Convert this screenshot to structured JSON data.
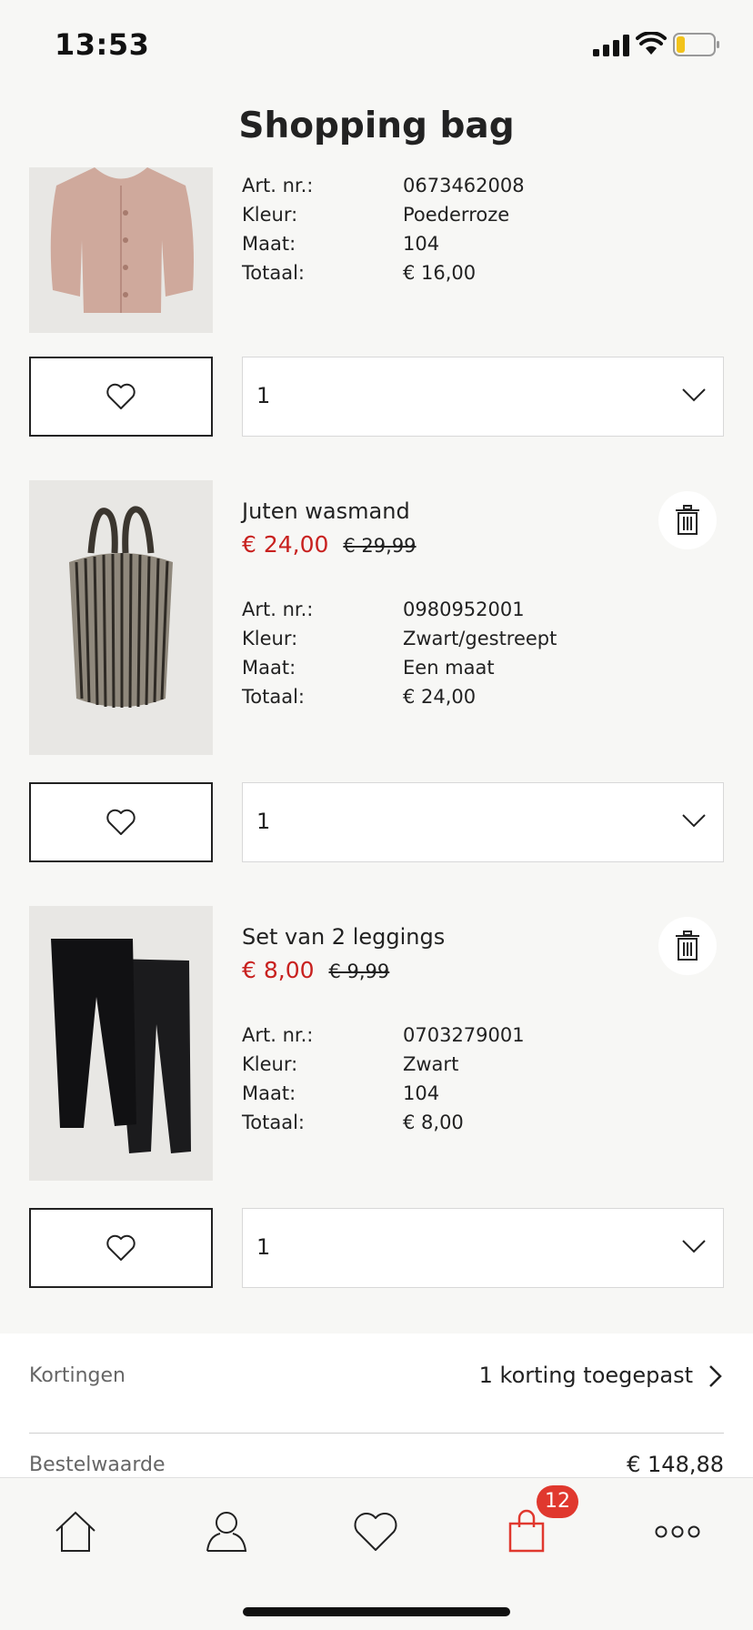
{
  "status_bar": {
    "time": "13:53"
  },
  "header": {
    "title": "Shopping bag"
  },
  "labels": {
    "art_nr": "Art. nr.:",
    "color": "Kleur:",
    "size": "Maat:",
    "total": "Totaal:"
  },
  "products": [
    {
      "name": "",
      "art_nr": "0673462008",
      "color": "Poederroze",
      "size": "104",
      "total": "€ 16,00",
      "quantity": "1",
      "image": "knit-cardigan-pink"
    },
    {
      "name": "Juten wasmand",
      "price": "€ 24,00",
      "old_price": "€ 29,99",
      "art_nr": "0980952001",
      "color": "Zwart/gestreept",
      "size": "Een maat",
      "total": "€ 24,00",
      "quantity": "1",
      "image": "jute-laundry-basket"
    },
    {
      "name": "Set van 2 leggings",
      "price": "€ 8,00",
      "old_price": "€ 9,99",
      "art_nr": "0703279001",
      "color": "Zwart",
      "size": "104",
      "total": "€ 8,00",
      "quantity": "1",
      "image": "black-leggings"
    }
  ],
  "summary": {
    "discounts_label": "Kortingen",
    "discounts_value": "1 korting toegepast",
    "order_value_label": "Bestelwaarde",
    "order_value": "€ 148,88"
  },
  "tab_bar": {
    "items": [
      "home-icon",
      "account-icon",
      "favorites-icon",
      "bag-icon",
      "more-icon"
    ],
    "bag_count": "12"
  },
  "colors": {
    "sale": "#c8211f",
    "badge": "#e0382e",
    "background": "#f7f7f5"
  }
}
